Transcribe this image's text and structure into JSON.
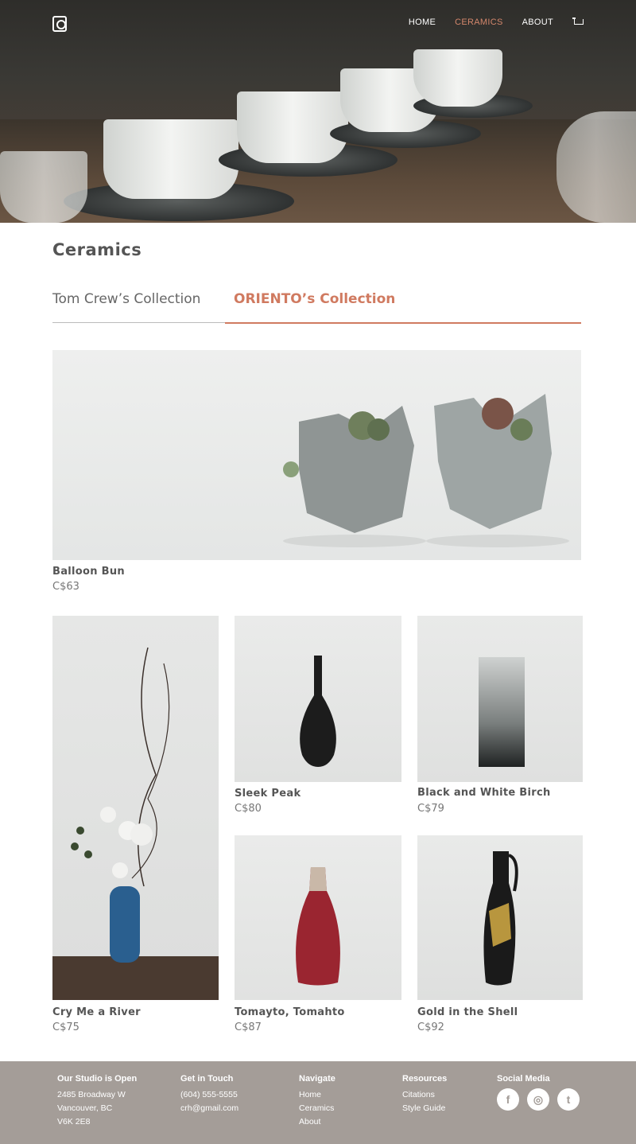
{
  "nav": {
    "items": [
      "HOME",
      "CERAMICS",
      "ABOUT"
    ],
    "active": "CERAMICS",
    "cart_icon": "cart-icon",
    "logo_icon": "logo-icon"
  },
  "page": {
    "title": "Ceramics",
    "tabs": [
      "Tom Crew’s Collection",
      "ORIENTO’s Collection"
    ],
    "active_tab": "ORIENTO’s Collection"
  },
  "products": [
    {
      "name": "Balloon Bun",
      "price": "C$63"
    },
    {
      "name": "Cry Me a River",
      "price": "C$75"
    },
    {
      "name": "Sleek Peak",
      "price": "C$80"
    },
    {
      "name": "Black and White Birch",
      "price": "C$79"
    },
    {
      "name": "Tomayto, Tomahto",
      "price": "C$87"
    },
    {
      "name": "Gold in the Shell",
      "price": "C$92"
    }
  ],
  "footer": {
    "studio": {
      "heading": "Our Studio is Open",
      "lines": [
        "2485 Broadway W",
        "Vancouver, BC",
        "V6K 2E8"
      ]
    },
    "contact": {
      "heading": "Get in Touch",
      "lines": [
        "(604) 555-5555",
        "crh@gmail.com"
      ]
    },
    "navigate": {
      "heading": "Navigate",
      "lines": [
        "Home",
        "Ceramics",
        "About"
      ]
    },
    "resources": {
      "heading": "Resources",
      "lines": [
        "Citations",
        "Style Guide"
      ]
    },
    "social": {
      "heading": "Social Media",
      "icons": [
        "facebook-icon",
        "instagram-icon",
        "twitter-icon"
      ]
    }
  },
  "colors": {
    "accent": "#d07a60",
    "footer_bg": "#a49d98"
  }
}
